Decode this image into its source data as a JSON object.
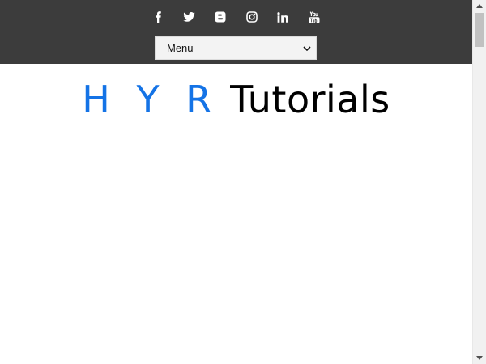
{
  "social": [
    {
      "name": "facebook"
    },
    {
      "name": "twitter"
    },
    {
      "name": "blogger"
    },
    {
      "name": "instagram"
    },
    {
      "name": "linkedin"
    },
    {
      "name": "youtube"
    }
  ],
  "nav": {
    "menu_label": "Menu"
  },
  "logo": {
    "brand": "H Y R",
    "rest": "Tutorials"
  },
  "colors": {
    "topbar": "#3c3c3c",
    "logo_blue": "#1473e6",
    "logo_black": "#000000",
    "select_bg": "#f3f3f3"
  },
  "icons": [
    "facebook-icon",
    "twitter-icon",
    "blogger-icon",
    "instagram-icon",
    "linkedin-icon",
    "youtube-icon",
    "chevron-down-icon"
  ]
}
